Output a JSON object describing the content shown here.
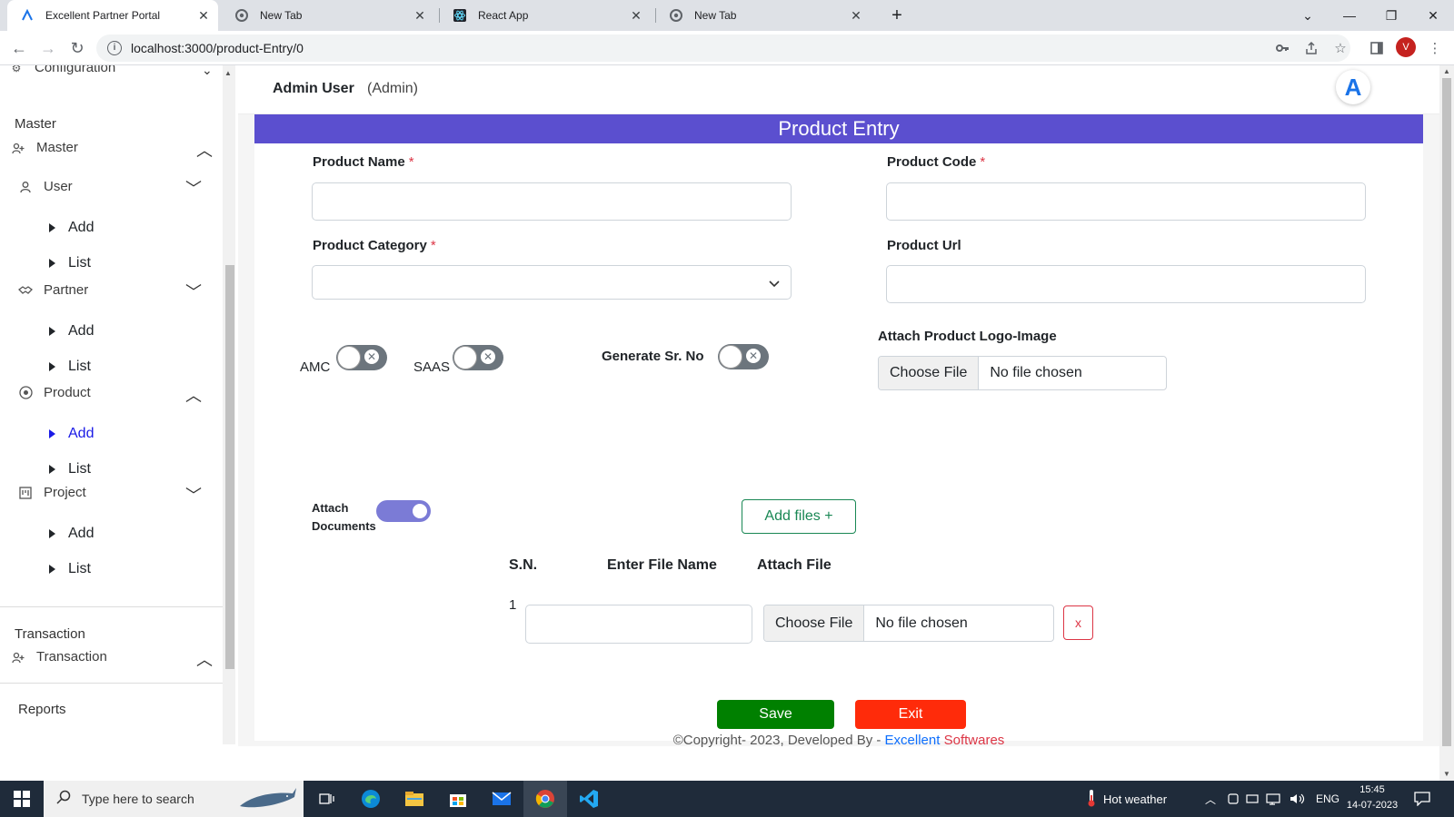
{
  "browser": {
    "tabs": [
      {
        "title": "Excellent Partner Portal",
        "active": true,
        "icon": "portal-logo-icon"
      },
      {
        "title": "New Tab",
        "active": false,
        "icon": "chrome-icon"
      },
      {
        "title": "React App",
        "active": false,
        "icon": "react-icon"
      },
      {
        "title": "New Tab",
        "active": false,
        "icon": "chrome-icon"
      }
    ],
    "new_tab": "+",
    "url": "localhost:3000/product-Entry/0",
    "profile_initial": "V"
  },
  "sidebar": {
    "partial_top_item": "Configuration",
    "sections": [
      {
        "heading": "Master"
      },
      {
        "heading": "Transaction"
      },
      {
        "heading": "Reports"
      }
    ],
    "master_group": "Master",
    "transaction_group": "Transaction",
    "reports": "Reports",
    "items": [
      {
        "label": "User",
        "expanded": false,
        "subs": [
          "Add",
          "List"
        ]
      },
      {
        "label": "Partner",
        "expanded": false,
        "subs": [
          "Add",
          "List"
        ]
      },
      {
        "label": "Product",
        "expanded": true,
        "subs": [
          "Add",
          "List"
        ],
        "active_sub": "Add"
      },
      {
        "label": "Project",
        "expanded": false,
        "subs": [
          "Add",
          "List"
        ]
      }
    ]
  },
  "header": {
    "user_name": "Admin User",
    "user_role": "(Admin)",
    "logo_letter": "A"
  },
  "form": {
    "title": "Product Entry",
    "product_name_label": "Product Name",
    "product_code_label": "Product Code",
    "product_category_label": "Product Category",
    "product_url_label": "Product Url",
    "required_mark": "*",
    "product_name_value": "",
    "product_code_value": "",
    "product_url_value": "",
    "amc_label": "AMC",
    "saas_label": "SAAS",
    "generate_sr_label": "Generate Sr. No",
    "amc_on": false,
    "saas_on": false,
    "generate_sr_on": false,
    "logo_label": "Attach Product Logo-Image",
    "choose_file": "Choose File",
    "no_file": "No file chosen",
    "attach_docs_line1": "Attach",
    "attach_docs_line2": "Documents",
    "attach_docs_on": true,
    "add_files": "Add files +",
    "table_headers": [
      "S.N.",
      "Enter File Name",
      "Attach File"
    ],
    "rows": [
      {
        "sn": "1",
        "file_name": "",
        "choose_file": "Choose File",
        "no_file": "No file chosen",
        "remove": "x"
      }
    ],
    "save": "Save",
    "exit": "Exit"
  },
  "footer": {
    "text": "©Copyright- 2023, Developed By - ",
    "brand1": "Excellent",
    "brand2": "Softwares"
  },
  "taskbar": {
    "search_placeholder": "Type here to search",
    "weather": "Hot weather",
    "language": "ENG",
    "time": "15:45",
    "date": "14-07-2023"
  },
  "colors": {
    "banner": "#5b4fcf",
    "save": "#008000",
    "exit": "#ff2b0a",
    "toggle_on": "#7b7bd6",
    "toggle_off": "#6c757d",
    "active_link": "#1a1ae6"
  }
}
